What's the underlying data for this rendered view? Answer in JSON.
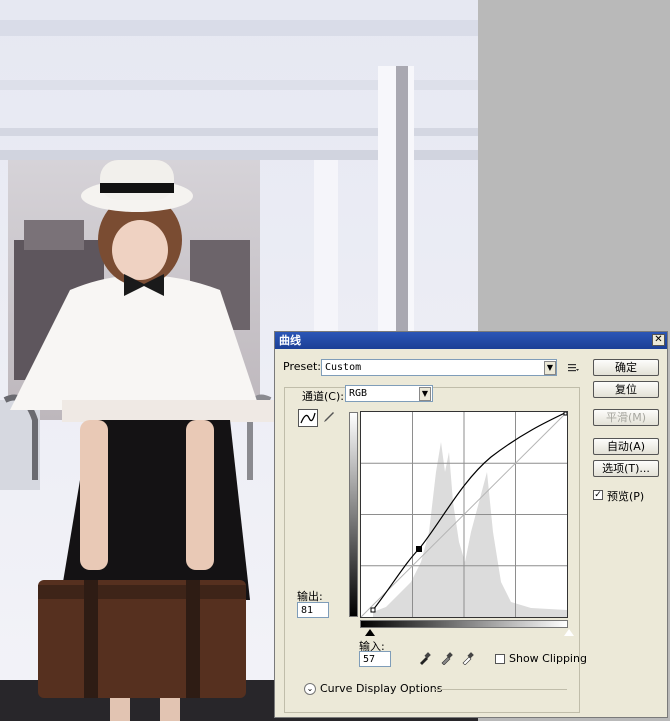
{
  "dialog": {
    "title": "曲线",
    "close_glyph": "✕",
    "preset_label": "Preset:",
    "preset_value": "Custom",
    "channel_label": "通道(C):",
    "channel_value": "RGB",
    "output_label": "输出:",
    "output_value": "81",
    "input_label": "输入:",
    "input_value": "57",
    "show_clipping_label": "Show Clipping",
    "show_clipping_checked": false,
    "curve_display_options_label": "Curve Display Options",
    "preview_label": "预览(P)",
    "preview_checked": true,
    "buttons": {
      "ok": "确定",
      "reset": "复位",
      "smooth": "平滑(M)",
      "auto": "自动(A)",
      "options": "选项(T)..."
    },
    "icons": {
      "curve_tool": "curve-point-icon",
      "pencil_tool": "pencil-icon",
      "preset_menu": "preset-options-icon",
      "black_eyedropper": "eyedropper-black-icon",
      "gray_eyedropper": "eyedropper-gray-icon",
      "white_eyedropper": "eyedropper-white-icon",
      "expand": "chevron-down-icon"
    }
  }
}
